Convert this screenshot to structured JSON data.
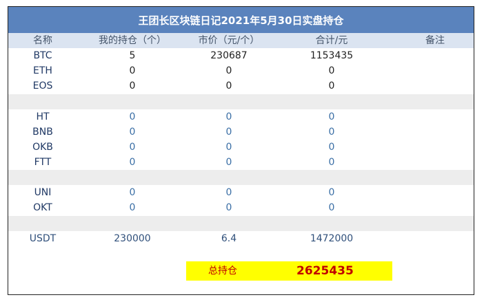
{
  "title": "王团长区块链日记2021年5月30日实盘持仓",
  "headers": {
    "name": "名称",
    "qty": "我的持仓（个）",
    "price": "市价（元/个）",
    "total": "合计/元",
    "note": "备注"
  },
  "rows": [
    {
      "name": "BTC",
      "qty": "5",
      "price": "230687",
      "total": "1153435",
      "note": ""
    },
    {
      "name": "ETH",
      "qty": "0",
      "price": "0",
      "total": "0",
      "note": ""
    },
    {
      "name": "EOS",
      "qty": "0",
      "price": "0",
      "total": "0",
      "note": ""
    },
    {
      "name": "HT",
      "qty": "0",
      "price": "0",
      "total": "0",
      "note": ""
    },
    {
      "name": "BNB",
      "qty": "0",
      "price": "0",
      "total": "0",
      "note": ""
    },
    {
      "name": "OKB",
      "qty": "0",
      "price": "0",
      "total": "0",
      "note": ""
    },
    {
      "name": "FTT",
      "qty": "0",
      "price": "0",
      "total": "0",
      "note": ""
    },
    {
      "name": "UNI",
      "qty": "0",
      "price": "0",
      "total": "0",
      "note": ""
    },
    {
      "name": "OKT",
      "qty": "0",
      "price": "0",
      "total": "0",
      "note": ""
    },
    {
      "name": "USDT",
      "qty": "230000",
      "price": "6.4",
      "total": "1472000",
      "note": ""
    }
  ],
  "summary": {
    "label": "总持仓",
    "value": "2625435"
  },
  "colors": {
    "title_bg": "#5a83bd",
    "header_bg": "#dbe4f1",
    "gap_row_bg": "#ededed",
    "summary_bg": "#ffff00",
    "summary_text": "#c00000"
  }
}
